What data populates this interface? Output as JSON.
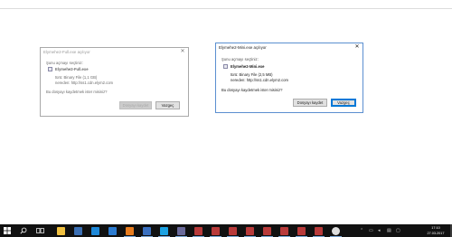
{
  "dialogs": {
    "left": {
      "title": "Elymehe2-Full.exe açılıyor",
      "open_text": "Şunu açmayı seçtiniz:",
      "filename": "Elymehe2-Full.exe",
      "type_label": "türü: Binary File (1,1 GB)",
      "source_label": "nereden: http://ss1.cdn.elym2.com",
      "question": "Bu dosyayı kaydetmek ister misiniz?",
      "save_button": "Dosyayı kaydet",
      "cancel_button": "Vazgeç"
    },
    "right": {
      "title": "Elymehe2-Mini.exe açılıyor",
      "open_text": "Şunu açmayı seçtiniz:",
      "filename": "Elymehe2-Mini.exe",
      "type_label": "türü: Binary File (2,5 MB)",
      "source_label": "nereden: http://ss1.cdn.elym2.com",
      "question": "Bu dosyayı kaydetmek ister misiniz?",
      "save_button": "Dosyayı kaydet",
      "cancel_button": "Vazgeç"
    }
  },
  "taskbar": {
    "clock_time": "17:10",
    "clock_date": "27.03.2017",
    "start_icon": "windows-logo-icon",
    "search_icon": "search-icon",
    "task_view_icon": "task-view-icon",
    "pinned": [
      {
        "name": "file-explorer-icon",
        "color": "#f0c040"
      },
      {
        "name": "store-icon",
        "color": "#3b6fb3"
      },
      {
        "name": "edge-icon",
        "color": "#1e88d8"
      },
      {
        "name": "photos-icon",
        "color": "#2b7bd0"
      },
      {
        "name": "firefox-icon",
        "color": "#e87c1e"
      },
      {
        "name": "app-icon",
        "color": "#3a70c0"
      },
      {
        "name": "skype-icon",
        "color": "#1ba1e2"
      },
      {
        "name": "app-icon",
        "color": "#6a6a9a"
      },
      {
        "name": "media-icon",
        "color": "#b83a3a"
      },
      {
        "name": "media-icon",
        "color": "#b83a3a"
      },
      {
        "name": "media-icon",
        "color": "#b83a3a"
      },
      {
        "name": "media-icon",
        "color": "#b83a3a"
      },
      {
        "name": "media-icon",
        "color": "#b83a3a"
      },
      {
        "name": "media-icon",
        "color": "#b83a3a"
      },
      {
        "name": "media-icon",
        "color": "#b83a3a"
      },
      {
        "name": "media-icon",
        "color": "#b83a3a"
      },
      {
        "name": "steam-icon",
        "color": "#dddddd"
      }
    ],
    "tray_icons": [
      "chevron-up-icon",
      "network-icon",
      "volume-icon",
      "keyboard-icon",
      "notification-icon"
    ]
  }
}
